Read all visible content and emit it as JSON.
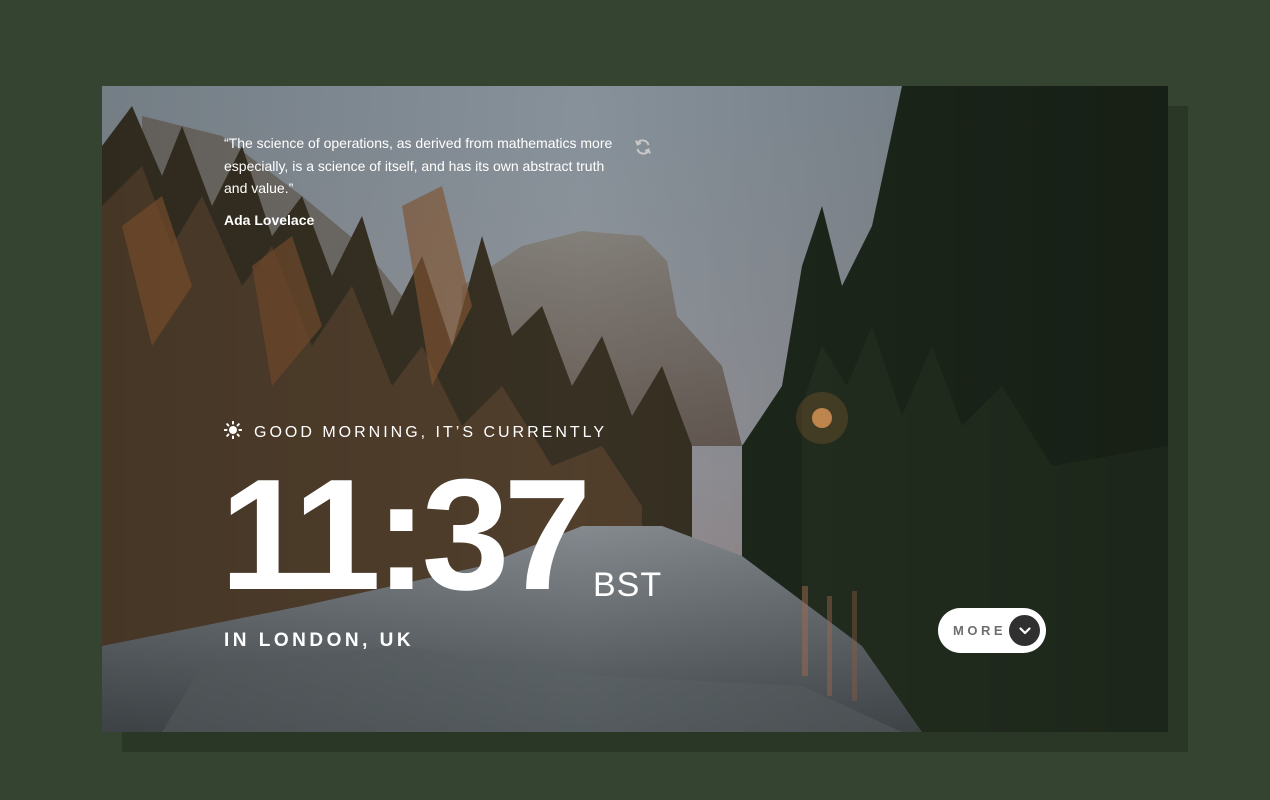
{
  "quote": {
    "text": "“The science of operations, as derived from mathematics more especially, is a science of itself, and has its own abstract truth and value.”",
    "author": "Ada Lovelace",
    "refresh_icon": "refresh-icon"
  },
  "greeting": {
    "icon": "sun-icon",
    "text": "GOOD MORNING, IT’S CURRENTLY"
  },
  "clock": {
    "time": "11:37",
    "timezone": "BST",
    "location": "IN LONDON, UK"
  },
  "more_button": {
    "label": "MORE",
    "icon": "chevron-down-icon"
  },
  "colors": {
    "page_background": "#354430",
    "text": "#ffffff",
    "button_background": "#ffffff",
    "button_text": "#6e6e6e",
    "chevron_circle": "#303030"
  }
}
